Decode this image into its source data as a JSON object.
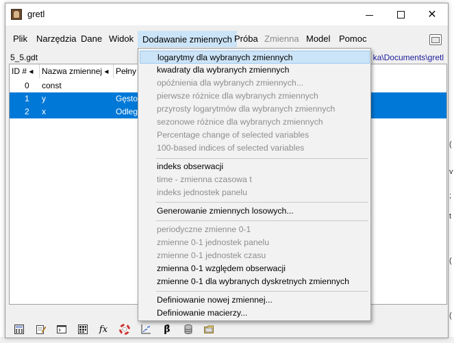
{
  "window": {
    "title": "gretl"
  },
  "menubar": [
    {
      "label": "Plik",
      "disabled": false,
      "active": false
    },
    {
      "label": "Narzędzia",
      "disabled": false,
      "active": false
    },
    {
      "label": "Dane",
      "disabled": false,
      "active": false
    },
    {
      "label": "Widok",
      "disabled": false,
      "active": false
    },
    {
      "label": "Dodawanie zmiennych",
      "disabled": false,
      "active": true
    },
    {
      "label": "Próba",
      "disabled": false,
      "active": false
    },
    {
      "label": "Zmienna",
      "disabled": true,
      "active": false
    },
    {
      "label": "Model",
      "disabled": false,
      "active": false
    },
    {
      "label": "Pomoc",
      "disabled": false,
      "active": false
    }
  ],
  "file": {
    "name": "5_5.gdt",
    "path_fragment": "ka\\Documents\\gretl"
  },
  "table": {
    "headers": [
      "ID # ◂",
      "Nazwa zmiennej ◂",
      "Pełny o"
    ],
    "rows": [
      {
        "id": "0",
        "name": "const",
        "desc": "",
        "selected": false
      },
      {
        "id": "1",
        "name": "y",
        "desc": "Gęstoś",
        "selected": true
      },
      {
        "id": "2",
        "name": "x",
        "desc": "Odległ",
        "selected": true
      }
    ]
  },
  "dropdown": {
    "items": [
      {
        "label": "logarytmy dla wybranych zmiennych",
        "disabled": false,
        "highlight": true
      },
      {
        "label": "kwadraty dla wybranych zmiennych",
        "disabled": false,
        "highlight": false
      },
      {
        "label": "opóźnienia dla wybranych zmiennych...",
        "disabled": true,
        "highlight": false
      },
      {
        "label": "pierwsze różnice dla wybranych zmiennych",
        "disabled": true,
        "highlight": false
      },
      {
        "label": "przyrosty logarytmów dla wybranych zmiennych",
        "disabled": true,
        "highlight": false
      },
      {
        "label": "sezonowe różnice dla wybranych zmiennych",
        "disabled": true,
        "highlight": false
      },
      {
        "label": "Percentage change of selected variables",
        "disabled": true,
        "highlight": false
      },
      {
        "label": "100-based indices of selected variables",
        "disabled": true,
        "highlight": false
      },
      {
        "label": "indeks obserwacji",
        "disabled": false,
        "highlight": false
      },
      {
        "label": "time - zmienna czasowa t",
        "disabled": true,
        "highlight": false
      },
      {
        "label": "indeks jednostek panelu",
        "disabled": true,
        "highlight": false
      },
      {
        "label": "Generowanie zmiennych losowych...",
        "disabled": false,
        "highlight": false
      },
      {
        "label": "periodyczne zmienne 0-1",
        "disabled": true,
        "highlight": false
      },
      {
        "label": "zmienne 0-1 jednostek panelu",
        "disabled": true,
        "highlight": false
      },
      {
        "label": "zmienne 0-1 jednostek czasu",
        "disabled": true,
        "highlight": false
      },
      {
        "label": "zmienna 0-1 względem obserwacji",
        "disabled": false,
        "highlight": false
      },
      {
        "label": "zmienne 0-1 dla wybranych dyskretnych zmiennych",
        "disabled": false,
        "highlight": false
      },
      {
        "label": "Definiowanie nowej zmiennej...",
        "disabled": false,
        "highlight": false
      },
      {
        "label": "Definiowanie macierzy...",
        "disabled": false,
        "highlight": false
      }
    ]
  },
  "toolbar": {
    "icons": [
      "calculator-icon",
      "notepad-icon",
      "terminal-icon",
      "session-icon",
      "function-icon",
      "help-icon",
      "scatter-plot-icon",
      "beta-icon",
      "database-icon",
      "folder-icon"
    ],
    "fx_label": "fx",
    "beta_label": "β̂"
  }
}
